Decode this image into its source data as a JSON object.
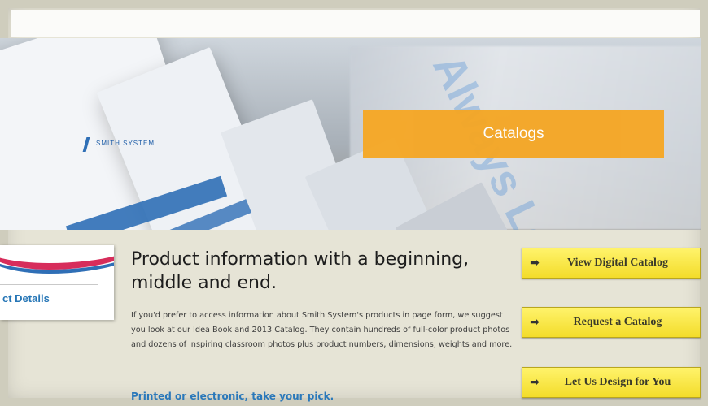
{
  "hero": {
    "banner_label": "Catalogs",
    "brand_logo_text": "SMITH SYSTEM",
    "sign_text": "Always Learning"
  },
  "side_card": {
    "link_label": "ct Details"
  },
  "main": {
    "heading": "Product information with a beginning, middle and end.",
    "paragraph": "If you'd prefer to access information about Smith System's products in page form, we suggest you look at our Idea Book and 2013 Catalog. They contain hundreds of full-color product photos and dozens of inspiring classroom photos plus product numbers, dimensions, weights and more.",
    "tagline": "Printed or electronic, take your pick."
  },
  "actions": [
    {
      "label": "View Digital Catalog",
      "icon": "arrow-right-icon"
    },
    {
      "label": "Request a Catalog",
      "icon": "arrow-right-icon"
    },
    {
      "label": "Let Us Design for You",
      "icon": "arrow-right-icon"
    }
  ],
  "colors": {
    "accent_orange": "#f5a623",
    "cta_yellow": "#f7e63a",
    "link_blue": "#2a78ba"
  }
}
